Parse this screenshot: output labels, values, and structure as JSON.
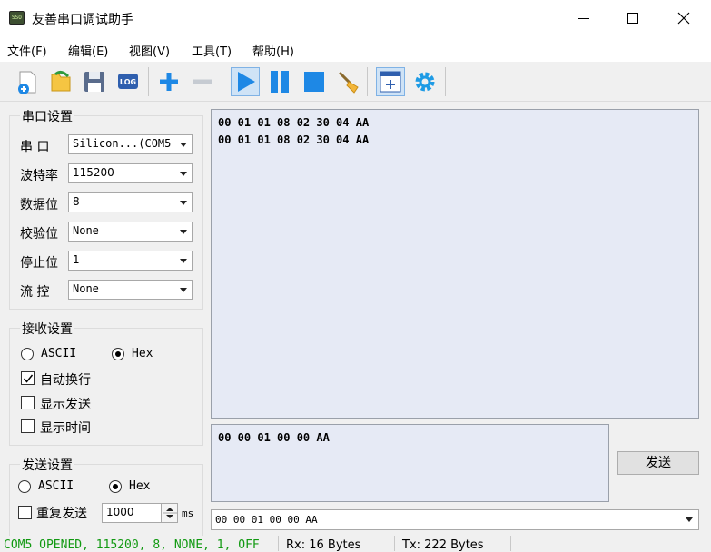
{
  "window": {
    "title": "友善串口调试助手",
    "icon": "app-icon"
  },
  "menu": [
    "文件(F)",
    "编辑(E)",
    "视图(V)",
    "工具(T)",
    "帮助(H)"
  ],
  "toolbar": {
    "icons": [
      "new-file-icon",
      "open-folder-icon",
      "save-icon",
      "log-icon",
      "add-icon",
      "remove-icon",
      "play-icon",
      "pause-icon",
      "stop-icon",
      "clear-broom-icon",
      "add-window-icon",
      "settings-gear-icon"
    ],
    "log_text": "LOG"
  },
  "serial_settings": {
    "title": "串口设置",
    "port": {
      "label": "串  口",
      "value": "Silicon...(COM5"
    },
    "baud": {
      "label": "波特率",
      "value": "115200"
    },
    "data_bits": {
      "label": "数据位",
      "value": "8"
    },
    "parity": {
      "label": "校验位",
      "value": "None"
    },
    "stop_bits": {
      "label": "停止位",
      "value": "1"
    },
    "flow": {
      "label": "流  控",
      "value": "None"
    }
  },
  "receive_settings": {
    "title": "接收设置",
    "ascii_label": "ASCII",
    "hex_label": "Hex",
    "mode": "Hex",
    "auto_newline": {
      "label": "自动换行",
      "checked": true
    },
    "show_send": {
      "label": "显示发送",
      "checked": false
    },
    "show_time": {
      "label": "显示时间",
      "checked": false
    }
  },
  "send_settings": {
    "title": "发送设置",
    "ascii_label": "ASCII",
    "hex_label": "Hex",
    "mode": "Hex",
    "repeat": {
      "label": "重复发送",
      "checked": false
    },
    "interval": "1000",
    "unit": "ms"
  },
  "receive_lines": [
    "00 01 01 08 02 30 04 AA",
    "00 01 01 08 02 30 04 AA"
  ],
  "send_text": "00 00 01 00 00 AA",
  "send_button": "发送",
  "history_value": "00 00 01 00 00 AA",
  "status": {
    "port": "COM5 OPENED, 115200, 8, NONE, 1, OFF",
    "rx": "Rx: 16 Bytes",
    "tx": "Tx: 222 Bytes"
  },
  "colors": {
    "status_green": "#119911",
    "panel_bg": "#e6eaf5",
    "accent_blue": "#1e88e5"
  }
}
